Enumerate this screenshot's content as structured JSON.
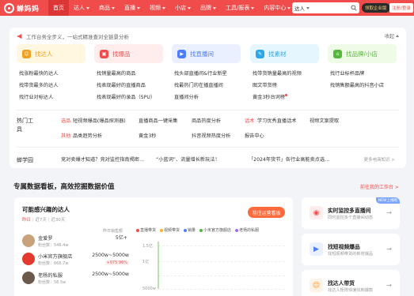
{
  "brand": {
    "name": "蝉妈妈"
  },
  "nav": {
    "items": [
      {
        "label": "首页",
        "active": true,
        "caret": false
      },
      {
        "label": "达人",
        "caret": true
      },
      {
        "label": "商品",
        "caret": true
      },
      {
        "label": "直播",
        "caret": true
      },
      {
        "label": "视频",
        "caret": true
      },
      {
        "label": "小店",
        "caret": true
      },
      {
        "label": "品牌",
        "caret": true
      },
      {
        "label": "工具/报表",
        "caret": true
      },
      {
        "label": "内容中心",
        "caret": true
      }
    ],
    "search_type": "达人",
    "search_placeholder": "",
    "enterprise_label": "领取企业版",
    "login_label": "注册/登录"
  },
  "workbench": {
    "header": "工作台务全步义，一站式精准查对全链景分析",
    "collapse_label": "收起",
    "columns": [
      {
        "tile": "找达人",
        "bg": "#fff7e0",
        "color": "#f0a020",
        "links": [
          "找涨粉最快的达人",
          "找带货最多的达人",
          "找行业对标达人"
        ]
      },
      {
        "tile": "找爆品",
        "bg": "#ffecec",
        "color": "#f04c4c",
        "links": [
          "找销量最高的商品",
          "找表现最好的直播商品",
          "找表现最好的录品（SPU）"
        ]
      },
      {
        "tile": "找直播间",
        "bg": "#eaf0ff",
        "color": "#4d7cff",
        "links": [
          "找头部直播间&行业新星",
          "找最热门的在播直播间",
          "直播间分析"
        ]
      },
      {
        "tile": "找素材",
        "bg": "#e6f6ff",
        "color": "#2ca7e8",
        "links": [
          "找带货销量最高的视频",
          "图文带货榜",
          "黄金3秒台词榜"
        ]
      },
      {
        "tile": "找品牌/小店",
        "bg": "#eefbe6",
        "color": "#54b83a",
        "links": [
          "找行业标杆品牌",
          "找销售额最高的抖音小店",
          ""
        ]
      }
    ],
    "hot_tools": {
      "title": "热门工具",
      "row1": {
        "tag": "选品",
        "items": [
          "短视频爆品(爆品探测器)",
          "直播商品一键采集",
          "商品热度分析"
        ],
        "tag2": "话术",
        "items2": [
          "学习优秀直播话术",
          "视频文案提取"
        ]
      },
      "row2": {
        "tag": "其他",
        "items": [
          "品类趋势分析",
          "黄金3秒",
          "抖音视频热度分析",
          "报告中心"
        ]
      }
    },
    "learn": {
      "title": "蝉学园",
      "items": [
        "竞对卖爆才知道？竞对监控指南揭密…",
        "“小蓝词”、流量增长新玩法！",
        "「2024年货节」各行业高能卖点选…"
      ],
      "more": "更多电商知识 >"
    }
  },
  "section": {
    "title": "专属数据看板，高效挖掘数据价值",
    "link": "前往我的工作台 >"
  },
  "board": {
    "title": "可能感兴趣的达人",
    "sub_tabs": [
      "昨日",
      "近7天",
      "近30天"
    ],
    "action": "前往运营看板",
    "rank_header": "昨日销售额",
    "rank_header_value": "5亿+",
    "rows": [
      {
        "name": "金爱罗",
        "fans": "粉丝数：546.4w",
        "value": "",
        "badge": "",
        "avatar": "#c8a27a"
      },
      {
        "name": "小米官方旗舰店",
        "fans": "粉丝数：666.7w",
        "value": "2500w~5000w",
        "badge": "+975.96%",
        "avatar": "#e23a2e"
      },
      {
        "name": "老杨的私服",
        "fans": "粉丝数：58.5w",
        "value": "2500w~5000w",
        "badge": "",
        "avatar": "#6b5a4a"
      }
    ],
    "legend": [
      {
        "label": "直播带货",
        "color": "#f04c4c"
      },
      {
        "label": "视频带货",
        "color": "#ffb020"
      },
      {
        "label": "销量",
        "color": "#4d7cff"
      },
      {
        "label": "小米官方旗舰店",
        "color": "#54b83a"
      },
      {
        "label": "老杨的私服",
        "color": "#9b6bff"
      }
    ],
    "y_ticks": [
      "1.5亿",
      "1亿",
      "",
      "5000w"
    ]
  },
  "right_cards": [
    {
      "title": "实时监控多直播间",
      "sub": "同时监控多个直播间动态",
      "color": "#f04c4c",
      "bg": "#ffecec",
      "badge": "NEW上线啦"
    },
    {
      "title": "找短视频爆品",
      "sub": "找短视频带货的新增爆品",
      "color": "#4d7cff",
      "bg": "#eaf0ff",
      "badge": ""
    },
    {
      "title": "找达人带货",
      "sub": "找达人矩阵快速找到爆款",
      "color": "#ff8a20",
      "bg": "#fff3e6",
      "badge": ""
    }
  ]
}
